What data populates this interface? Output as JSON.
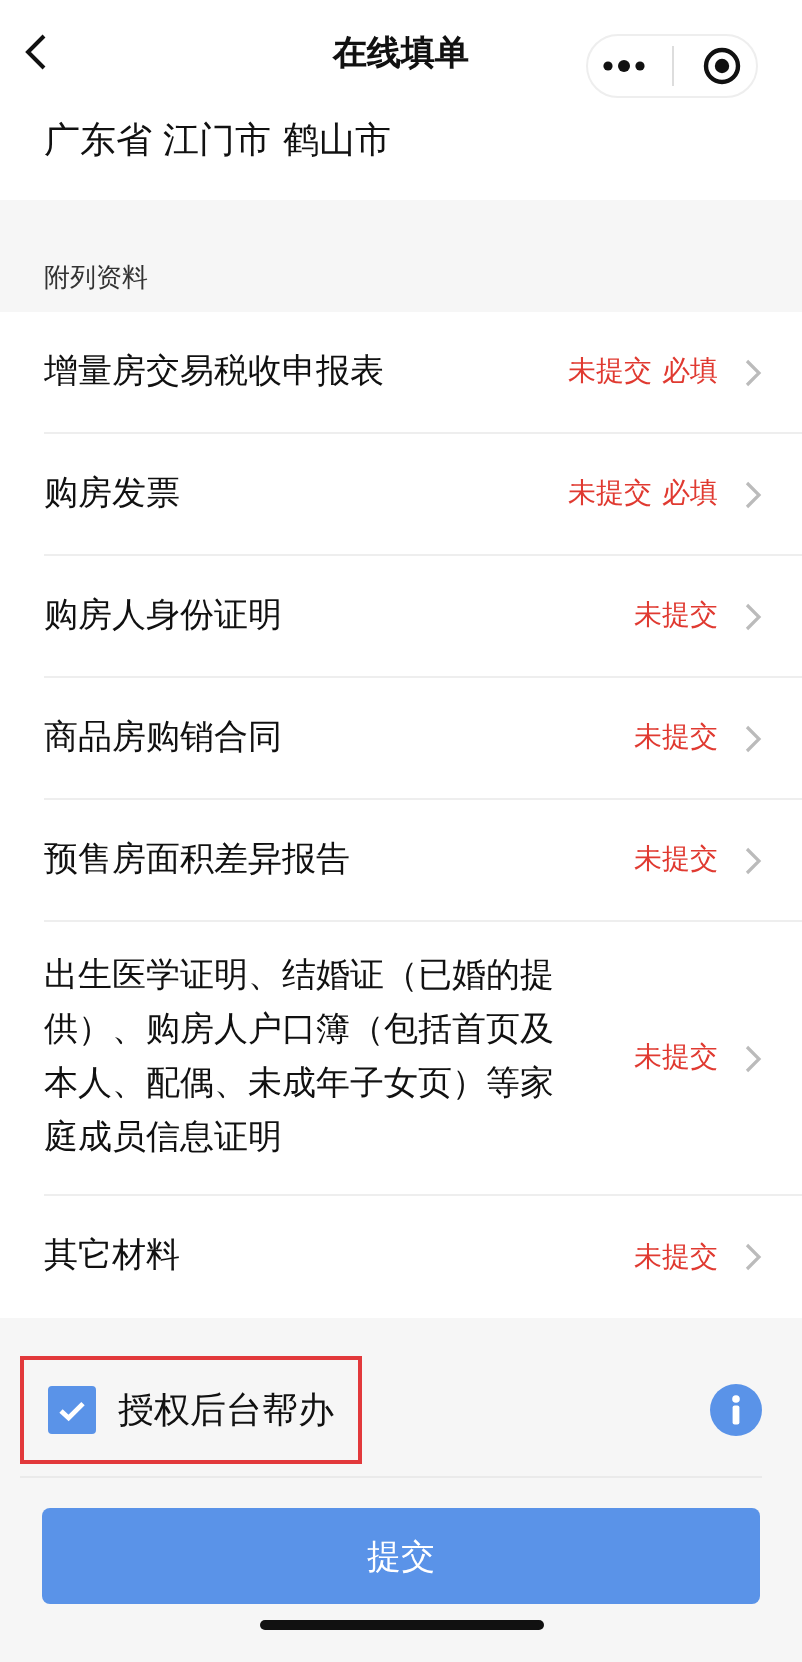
{
  "nav": {
    "title": "在线填单"
  },
  "address": "广东省 江门市 鹤山市",
  "section_label": "附列资料",
  "items": [
    {
      "label": "增量房交易税收申报表",
      "tags": [
        "未提交",
        "必填"
      ]
    },
    {
      "label": "购房发票",
      "tags": [
        "未提交",
        "必填"
      ]
    },
    {
      "label": "购房人身份证明",
      "tags": [
        "未提交"
      ]
    },
    {
      "label": "商品房购销合同",
      "tags": [
        "未提交"
      ]
    },
    {
      "label": "预售房面积差异报告",
      "tags": [
        "未提交"
      ]
    },
    {
      "label": "出生医学证明、结婚证（已婚的提供）、购房人户口簿（包括首页及本人、配偶、未成年子女页）等家庭成员信息证明",
      "tags": [
        "未提交"
      ]
    },
    {
      "label": "其它材料",
      "tags": [
        "未提交"
      ]
    }
  ],
  "authorize": {
    "label": "授权后台帮办",
    "checked": true,
    "highlighted": true
  },
  "submit": "提交"
}
